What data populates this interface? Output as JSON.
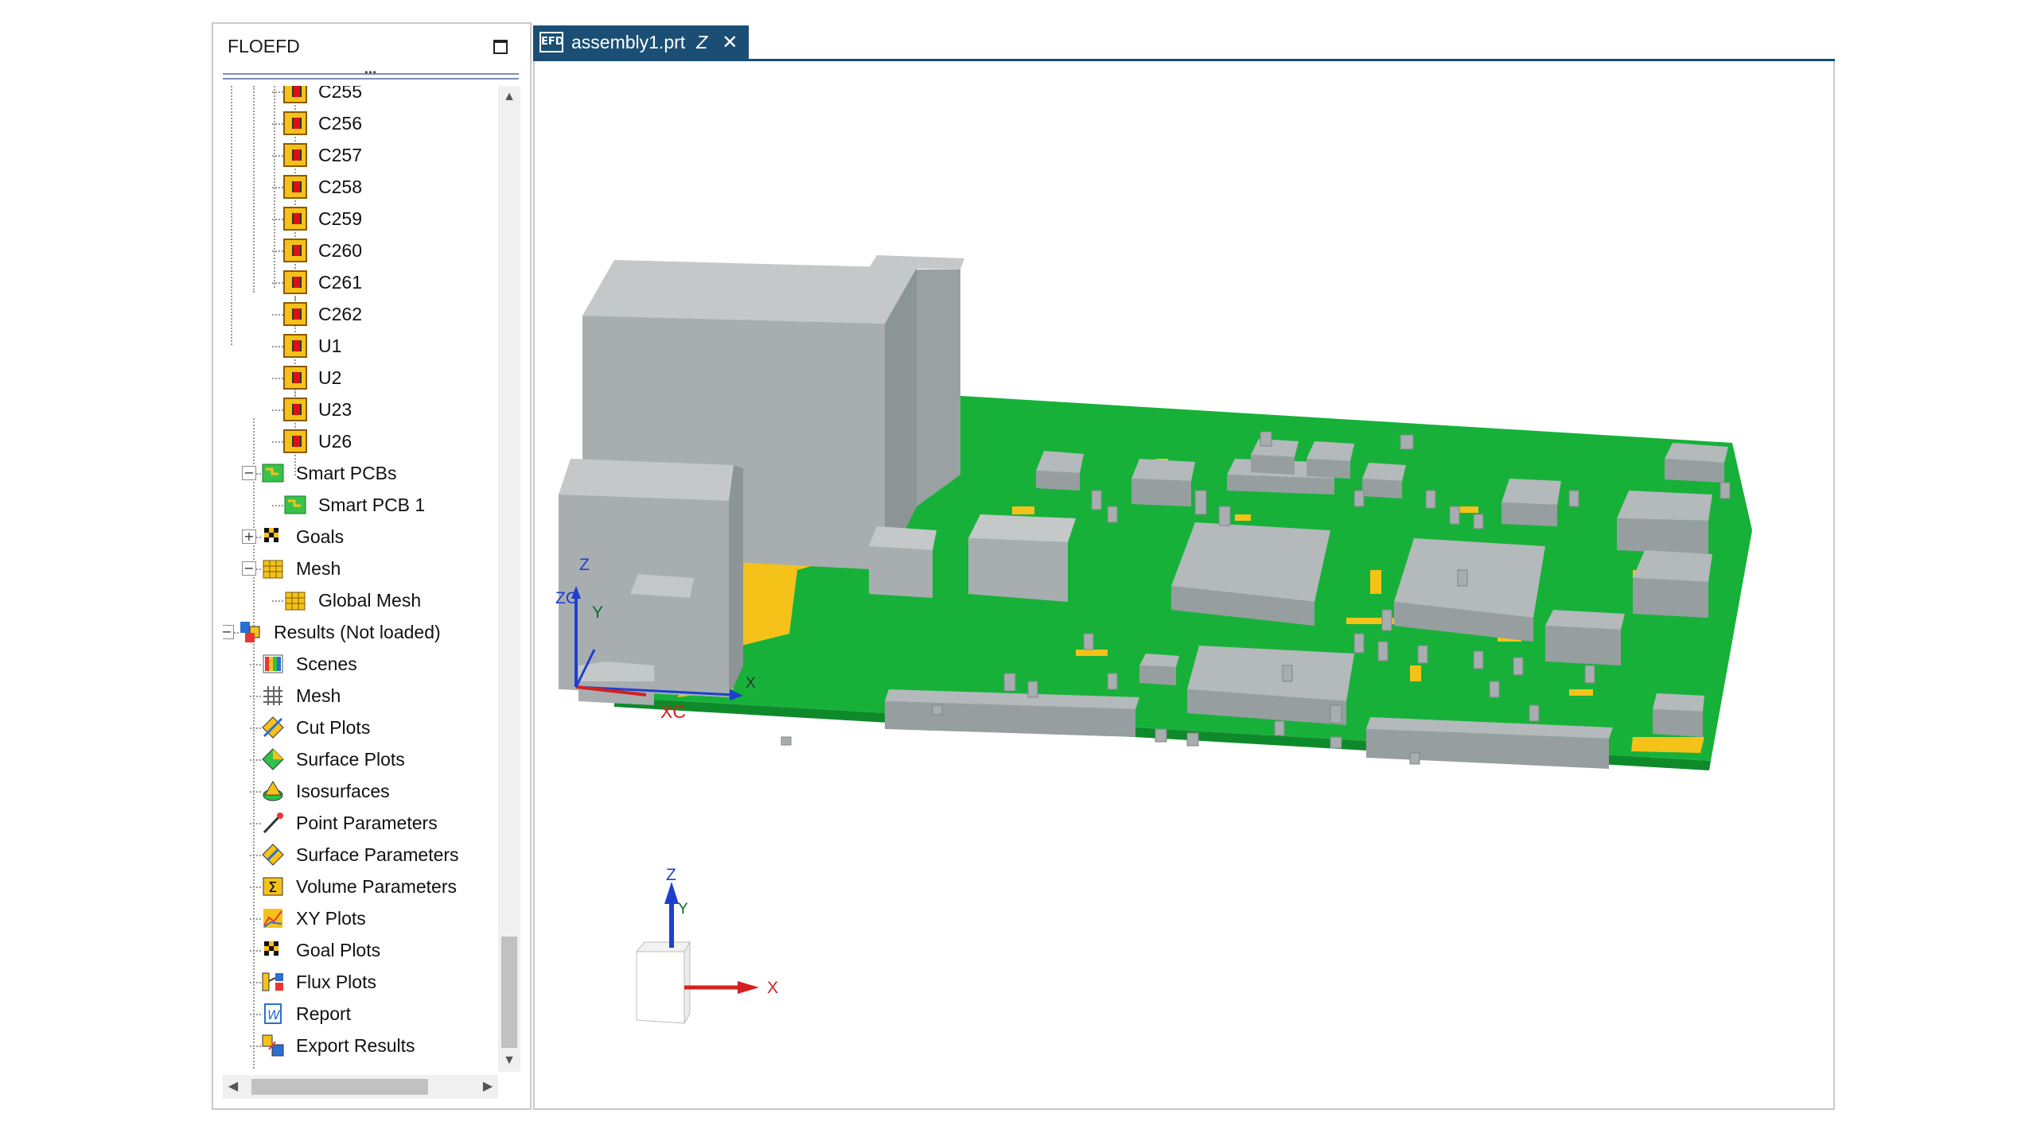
{
  "panel": {
    "title": "FLOEFD",
    "splitter_dots": "•••",
    "tree": {
      "components": [
        "C255",
        "C256",
        "C257",
        "C258",
        "C259",
        "C260",
        "C261",
        "C262",
        "U1",
        "U2",
        "U23",
        "U26"
      ],
      "smart_pcbs": {
        "label": "Smart PCBs",
        "child": "Smart PCB 1"
      },
      "goals": "Goals",
      "mesh": {
        "label": "Mesh",
        "child": "Global Mesh"
      },
      "results": {
        "label": "Results (Not loaded)",
        "items": [
          "Scenes",
          "Mesh",
          "Cut Plots",
          "Surface Plots",
          "Isosurfaces",
          "Point Parameters",
          "Surface Parameters",
          "Volume Parameters",
          "XY Plots",
          "Goal Plots",
          "Flux Plots",
          "Report",
          "Export Results"
        ]
      }
    },
    "scroll": {
      "up": "▲",
      "down": "▼",
      "left": "◀",
      "right": "▶"
    }
  },
  "tab": {
    "icon_text": "EFD",
    "title": "assembly1.prt",
    "suffix": "Z",
    "close": "✕"
  },
  "viewport": {
    "wcs": {
      "z": "Z",
      "zc": "ZC",
      "y": "Y",
      "x": "X",
      "xc": "XC"
    },
    "triad": {
      "z": "Z",
      "y": "Y",
      "x": "X"
    }
  },
  "colors": {
    "accent": "#1b4e74",
    "board_green": "#17b13a",
    "copper_yellow": "#f5c21a",
    "component_gray": "#a8aeb0",
    "axis_red": "#d42020",
    "axis_blue": "#1f3fcf"
  }
}
